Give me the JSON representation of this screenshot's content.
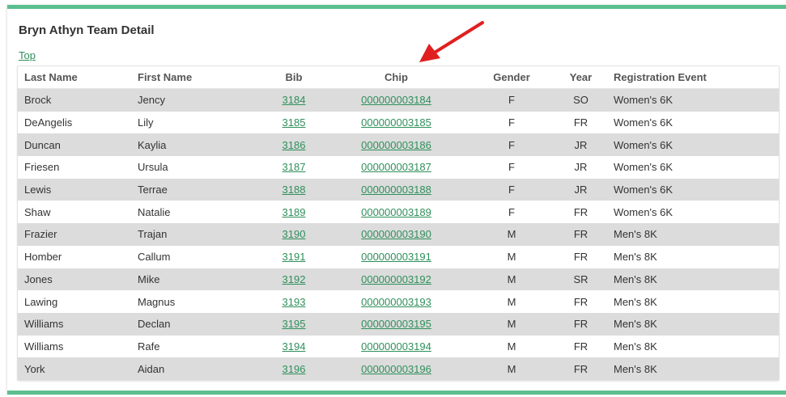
{
  "page": {
    "title": "Bryn Athyn Team Detail",
    "top_link": "Top"
  },
  "colors": {
    "accent": "#5bbf8f",
    "link": "#2f8f5b",
    "row_alt": "#dcdcdc",
    "arrow": "#e02020"
  },
  "table": {
    "headers": {
      "last_name": "Last Name",
      "first_name": "First Name",
      "bib": "Bib",
      "chip": "Chip",
      "gender": "Gender",
      "year": "Year",
      "event": "Registration Event"
    },
    "rows": [
      {
        "last": "Brock",
        "first": "Jency",
        "bib": "3184",
        "chip": "000000003184",
        "gender": "F",
        "year": "SO",
        "event": "Women's 6K"
      },
      {
        "last": "DeAngelis",
        "first": "Lily",
        "bib": "3185",
        "chip": "000000003185",
        "gender": "F",
        "year": "FR",
        "event": "Women's 6K"
      },
      {
        "last": "Duncan",
        "first": "Kaylia",
        "bib": "3186",
        "chip": "000000003186",
        "gender": "F",
        "year": "JR",
        "event": "Women's 6K"
      },
      {
        "last": "Friesen",
        "first": "Ursula",
        "bib": "3187",
        "chip": "000000003187",
        "gender": "F",
        "year": "JR",
        "event": "Women's 6K"
      },
      {
        "last": "Lewis",
        "first": "Terrae",
        "bib": "3188",
        "chip": "000000003188",
        "gender": "F",
        "year": "JR",
        "event": "Women's 6K"
      },
      {
        "last": "Shaw",
        "first": "Natalie",
        "bib": "3189",
        "chip": "000000003189",
        "gender": "F",
        "year": "FR",
        "event": "Women's 6K"
      },
      {
        "last": "Frazier",
        "first": "Trajan",
        "bib": "3190",
        "chip": "000000003190",
        "gender": "M",
        "year": "FR",
        "event": "Men's 8K"
      },
      {
        "last": "Homber",
        "first": "Callum",
        "bib": "3191",
        "chip": "000000003191",
        "gender": "M",
        "year": "FR",
        "event": "Men's 8K"
      },
      {
        "last": "Jones",
        "first": "Mike",
        "bib": "3192",
        "chip": "000000003192",
        "gender": "M",
        "year": "SR",
        "event": "Men's 8K"
      },
      {
        "last": "Lawing",
        "first": "Magnus",
        "bib": "3193",
        "chip": "000000003193",
        "gender": "M",
        "year": "FR",
        "event": "Men's 8K"
      },
      {
        "last": "Williams",
        "first": "Declan",
        "bib": "3195",
        "chip": "000000003195",
        "gender": "M",
        "year": "FR",
        "event": "Men's 8K"
      },
      {
        "last": "Williams",
        "first": "Rafe",
        "bib": "3194",
        "chip": "000000003194",
        "gender": "M",
        "year": "FR",
        "event": "Men's 8K"
      },
      {
        "last": "York",
        "first": "Aidan",
        "bib": "3196",
        "chip": "000000003196",
        "gender": "M",
        "year": "FR",
        "event": "Men's 8K"
      }
    ]
  },
  "annotation": {
    "icon": "red-arrow-icon"
  }
}
